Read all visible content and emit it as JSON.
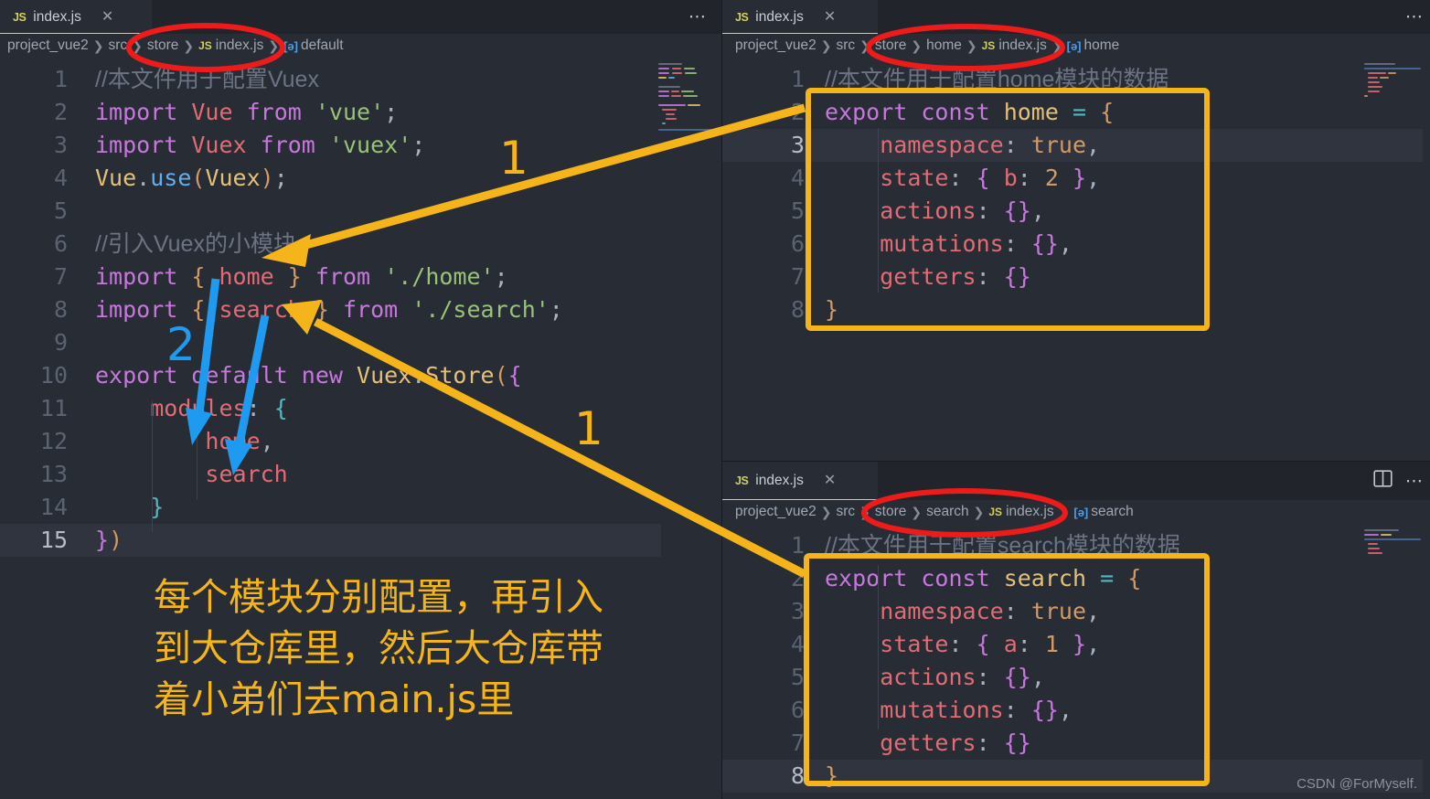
{
  "app": {
    "theme_bg": "#282c34",
    "accent_yellow": "#f5b41a",
    "accent_blue": "#1e9bf0",
    "accent_red": "#ee1b1b"
  },
  "watermark": "CSDN @ForMyself.",
  "panels": {
    "left": {
      "tab": {
        "icon": "js-file-icon",
        "label": "index.js",
        "close": "✕"
      },
      "overflow_label": "⋯",
      "breadcrumb": {
        "segments": [
          "project_vue2",
          "src",
          "store",
          "index.js",
          "default"
        ],
        "separator": "❯",
        "file_icon": "JS",
        "symbol_icon": "[ə]"
      },
      "code": [
        {
          "n": "1",
          "indent": 0,
          "tokens": [
            {
              "t": "//本文件用于配置Vuex",
              "c": "cmt"
            }
          ]
        },
        {
          "n": "2",
          "indent": 0,
          "tokens": [
            {
              "t": "import",
              "c": "kw"
            },
            {
              "t": " ",
              "c": ""
            },
            {
              "t": "Vue",
              "c": "var"
            },
            {
              "t": " ",
              "c": ""
            },
            {
              "t": "from",
              "c": "kw"
            },
            {
              "t": " ",
              "c": ""
            },
            {
              "t": "'vue'",
              "c": "str"
            },
            {
              "t": ";",
              "c": ""
            }
          ]
        },
        {
          "n": "3",
          "indent": 0,
          "tokens": [
            {
              "t": "import",
              "c": "kw"
            },
            {
              "t": " ",
              "c": ""
            },
            {
              "t": "Vuex",
              "c": "var"
            },
            {
              "t": " ",
              "c": ""
            },
            {
              "t": "from",
              "c": "kw"
            },
            {
              "t": " ",
              "c": ""
            },
            {
              "t": "'vuex'",
              "c": "str"
            },
            {
              "t": ";",
              "c": ""
            }
          ]
        },
        {
          "n": "4",
          "indent": 0,
          "tokens": [
            {
              "t": "Vue",
              "c": "cls"
            },
            {
              "t": ".",
              "c": ""
            },
            {
              "t": "use",
              "c": "fn"
            },
            {
              "t": "(",
              "c": "brc"
            },
            {
              "t": "Vuex",
              "c": "cls"
            },
            {
              "t": ")",
              "c": "brc"
            },
            {
              "t": ";",
              "c": ""
            }
          ]
        },
        {
          "n": "5",
          "indent": 0,
          "tokens": []
        },
        {
          "n": "6",
          "indent": 0,
          "tokens": [
            {
              "t": "//引入Vuex的小模块",
              "c": "cmt"
            }
          ]
        },
        {
          "n": "7",
          "indent": 0,
          "tokens": [
            {
              "t": "import",
              "c": "kw"
            },
            {
              "t": " ",
              "c": ""
            },
            {
              "t": "{",
              "c": "brc"
            },
            {
              "t": " ",
              "c": ""
            },
            {
              "t": "home",
              "c": "var"
            },
            {
              "t": " ",
              "c": ""
            },
            {
              "t": "}",
              "c": "brc"
            },
            {
              "t": " ",
              "c": ""
            },
            {
              "t": "from",
              "c": "kw"
            },
            {
              "t": " ",
              "c": ""
            },
            {
              "t": "'./home'",
              "c": "str"
            },
            {
              "t": ";",
              "c": ""
            }
          ]
        },
        {
          "n": "8",
          "indent": 0,
          "tokens": [
            {
              "t": "import",
              "c": "kw"
            },
            {
              "t": " ",
              "c": ""
            },
            {
              "t": "{",
              "c": "brc"
            },
            {
              "t": " ",
              "c": ""
            },
            {
              "t": "search",
              "c": "var"
            },
            {
              "t": " ",
              "c": ""
            },
            {
              "t": "}",
              "c": "brc"
            },
            {
              "t": " ",
              "c": ""
            },
            {
              "t": "from",
              "c": "kw"
            },
            {
              "t": " ",
              "c": ""
            },
            {
              "t": "'./search'",
              "c": "str"
            },
            {
              "t": ";",
              "c": ""
            }
          ]
        },
        {
          "n": "9",
          "indent": 0,
          "tokens": []
        },
        {
          "n": "10",
          "indent": 0,
          "tokens": [
            {
              "t": "export",
              "c": "kw"
            },
            {
              "t": " ",
              "c": ""
            },
            {
              "t": "default",
              "c": "kw"
            },
            {
              "t": " ",
              "c": ""
            },
            {
              "t": "new",
              "c": "kw"
            },
            {
              "t": " ",
              "c": ""
            },
            {
              "t": "Vuex",
              "c": "cls"
            },
            {
              "t": ".",
              "c": ""
            },
            {
              "t": "Store",
              "c": "cls"
            },
            {
              "t": "(",
              "c": "brc"
            },
            {
              "t": "{",
              "c": "brc2"
            }
          ]
        },
        {
          "n": "11",
          "indent": 0,
          "tokens": [
            {
              "t": "    ",
              "c": ""
            },
            {
              "t": "modules",
              "c": "var"
            },
            {
              "t": ":",
              "c": ""
            },
            {
              "t": " ",
              "c": ""
            },
            {
              "t": "{",
              "c": "brc3"
            }
          ]
        },
        {
          "n": "12",
          "indent": 0,
          "tokens": [
            {
              "t": "        ",
              "c": ""
            },
            {
              "t": "home",
              "c": "var"
            },
            {
              "t": ",",
              "c": ""
            }
          ]
        },
        {
          "n": "13",
          "indent": 0,
          "tokens": [
            {
              "t": "        ",
              "c": ""
            },
            {
              "t": "search",
              "c": "var"
            }
          ]
        },
        {
          "n": "14",
          "indent": 0,
          "tokens": [
            {
              "t": "    ",
              "c": ""
            },
            {
              "t": "}",
              "c": "brc3"
            }
          ]
        },
        {
          "n": "15",
          "indent": 0,
          "tokens": [
            {
              "t": "}",
              "c": "brc2"
            },
            {
              "t": ")",
              "c": "brc"
            }
          ]
        }
      ],
      "current_line": "15"
    },
    "top_right": {
      "tab": {
        "icon": "js-file-icon",
        "label": "index.js",
        "close": "✕"
      },
      "overflow_label": "⋯",
      "breadcrumb": {
        "segments": [
          "project_vue2",
          "src",
          "store",
          "home",
          "index.js",
          "home"
        ],
        "separator": "❯",
        "file_icon": "JS",
        "symbol_icon": "[ə]"
      },
      "code": [
        {
          "n": "1",
          "tokens": [
            {
              "t": "//本文件用于配置home模块的数据",
              "c": "cmt"
            }
          ]
        },
        {
          "n": "2",
          "tokens": [
            {
              "t": "export",
              "c": "kw"
            },
            {
              "t": " ",
              "c": ""
            },
            {
              "t": "const",
              "c": "kw"
            },
            {
              "t": " ",
              "c": ""
            },
            {
              "t": "home",
              "c": "cls"
            },
            {
              "t": " ",
              "c": ""
            },
            {
              "t": "=",
              "c": "op"
            },
            {
              "t": " ",
              "c": ""
            },
            {
              "t": "{",
              "c": "brc"
            }
          ]
        },
        {
          "n": "3",
          "tokens": [
            {
              "t": "    ",
              "c": ""
            },
            {
              "t": "namespace",
              "c": "var"
            },
            {
              "t": ":",
              "c": ""
            },
            {
              "t": " ",
              "c": ""
            },
            {
              "t": "true",
              "c": "num"
            },
            {
              "t": ",",
              "c": ""
            }
          ]
        },
        {
          "n": "4",
          "tokens": [
            {
              "t": "    ",
              "c": ""
            },
            {
              "t": "state",
              "c": "var"
            },
            {
              "t": ":",
              "c": ""
            },
            {
              "t": " ",
              "c": ""
            },
            {
              "t": "{",
              "c": "brc2"
            },
            {
              "t": " ",
              "c": ""
            },
            {
              "t": "b",
              "c": "var"
            },
            {
              "t": ":",
              "c": ""
            },
            {
              "t": " ",
              "c": ""
            },
            {
              "t": "2",
              "c": "num"
            },
            {
              "t": " ",
              "c": ""
            },
            {
              "t": "}",
              "c": "brc2"
            },
            {
              "t": ",",
              "c": ""
            }
          ]
        },
        {
          "n": "5",
          "tokens": [
            {
              "t": "    ",
              "c": ""
            },
            {
              "t": "actions",
              "c": "var"
            },
            {
              "t": ":",
              "c": ""
            },
            {
              "t": " ",
              "c": ""
            },
            {
              "t": "{}",
              "c": "brc2"
            },
            {
              "t": ",",
              "c": ""
            }
          ]
        },
        {
          "n": "6",
          "tokens": [
            {
              "t": "    ",
              "c": ""
            },
            {
              "t": "mutations",
              "c": "var"
            },
            {
              "t": ":",
              "c": ""
            },
            {
              "t": " ",
              "c": ""
            },
            {
              "t": "{}",
              "c": "brc2"
            },
            {
              "t": ",",
              "c": ""
            }
          ]
        },
        {
          "n": "7",
          "tokens": [
            {
              "t": "    ",
              "c": ""
            },
            {
              "t": "getters",
              "c": "var"
            },
            {
              "t": ":",
              "c": ""
            },
            {
              "t": " ",
              "c": ""
            },
            {
              "t": "{}",
              "c": "brc2"
            }
          ]
        },
        {
          "n": "8",
          "tokens": [
            {
              "t": "}",
              "c": "brc"
            }
          ]
        }
      ],
      "current_line": "3"
    },
    "bottom_right": {
      "tab": {
        "icon": "js-file-icon",
        "label": "index.js",
        "close": "✕"
      },
      "split_label": "⬚",
      "overflow_label": "⋯",
      "breadcrumb": {
        "segments": [
          "project_vue2",
          "src",
          "store",
          "search",
          "index.js",
          "search"
        ],
        "separator": "❯",
        "file_icon": "JS",
        "symbol_icon": "[ə]"
      },
      "code": [
        {
          "n": "1",
          "tokens": [
            {
              "t": "//本文件用于配置search模块的数据",
              "c": "cmt"
            }
          ]
        },
        {
          "n": "2",
          "tokens": [
            {
              "t": "export",
              "c": "kw"
            },
            {
              "t": " ",
              "c": ""
            },
            {
              "t": "const",
              "c": "kw"
            },
            {
              "t": " ",
              "c": ""
            },
            {
              "t": "search",
              "c": "cls"
            },
            {
              "t": " ",
              "c": ""
            },
            {
              "t": "=",
              "c": "op"
            },
            {
              "t": " ",
              "c": ""
            },
            {
              "t": "{",
              "c": "brc"
            }
          ]
        },
        {
          "n": "3",
          "tokens": [
            {
              "t": "    ",
              "c": ""
            },
            {
              "t": "namespace",
              "c": "var"
            },
            {
              "t": ":",
              "c": ""
            },
            {
              "t": " ",
              "c": ""
            },
            {
              "t": "true",
              "c": "num"
            },
            {
              "t": ",",
              "c": ""
            }
          ]
        },
        {
          "n": "4",
          "tokens": [
            {
              "t": "    ",
              "c": ""
            },
            {
              "t": "state",
              "c": "var"
            },
            {
              "t": ":",
              "c": ""
            },
            {
              "t": " ",
              "c": ""
            },
            {
              "t": "{",
              "c": "brc2"
            },
            {
              "t": " ",
              "c": ""
            },
            {
              "t": "a",
              "c": "var"
            },
            {
              "t": ":",
              "c": ""
            },
            {
              "t": " ",
              "c": ""
            },
            {
              "t": "1",
              "c": "num"
            },
            {
              "t": " ",
              "c": ""
            },
            {
              "t": "}",
              "c": "brc2"
            },
            {
              "t": ",",
              "c": ""
            }
          ]
        },
        {
          "n": "5",
          "tokens": [
            {
              "t": "    ",
              "c": ""
            },
            {
              "t": "actions",
              "c": "var"
            },
            {
              "t": ":",
              "c": ""
            },
            {
              "t": " ",
              "c": ""
            },
            {
              "t": "{}",
              "c": "brc2"
            },
            {
              "t": ",",
              "c": ""
            }
          ]
        },
        {
          "n": "6",
          "tokens": [
            {
              "t": "    ",
              "c": ""
            },
            {
              "t": "mutations",
              "c": "var"
            },
            {
              "t": ":",
              "c": ""
            },
            {
              "t": " ",
              "c": ""
            },
            {
              "t": "{}",
              "c": "brc2"
            },
            {
              "t": ",",
              "c": ""
            }
          ]
        },
        {
          "n": "7",
          "tokens": [
            {
              "t": "    ",
              "c": ""
            },
            {
              "t": "getters",
              "c": "var"
            },
            {
              "t": ":",
              "c": ""
            },
            {
              "t": " ",
              "c": ""
            },
            {
              "t": "{}",
              "c": "brc2"
            }
          ]
        },
        {
          "n": "8",
          "tokens": [
            {
              "t": "}",
              "c": "brc"
            }
          ]
        }
      ],
      "current_line": "8"
    }
  },
  "annotations": {
    "note_lines": [
      "每个模块分别配置，再引入",
      "到大仓库里，然后大仓库带",
      "着小弟们去main.js里"
    ],
    "label_1a": "1",
    "label_1b": "1",
    "label_2": "2"
  }
}
